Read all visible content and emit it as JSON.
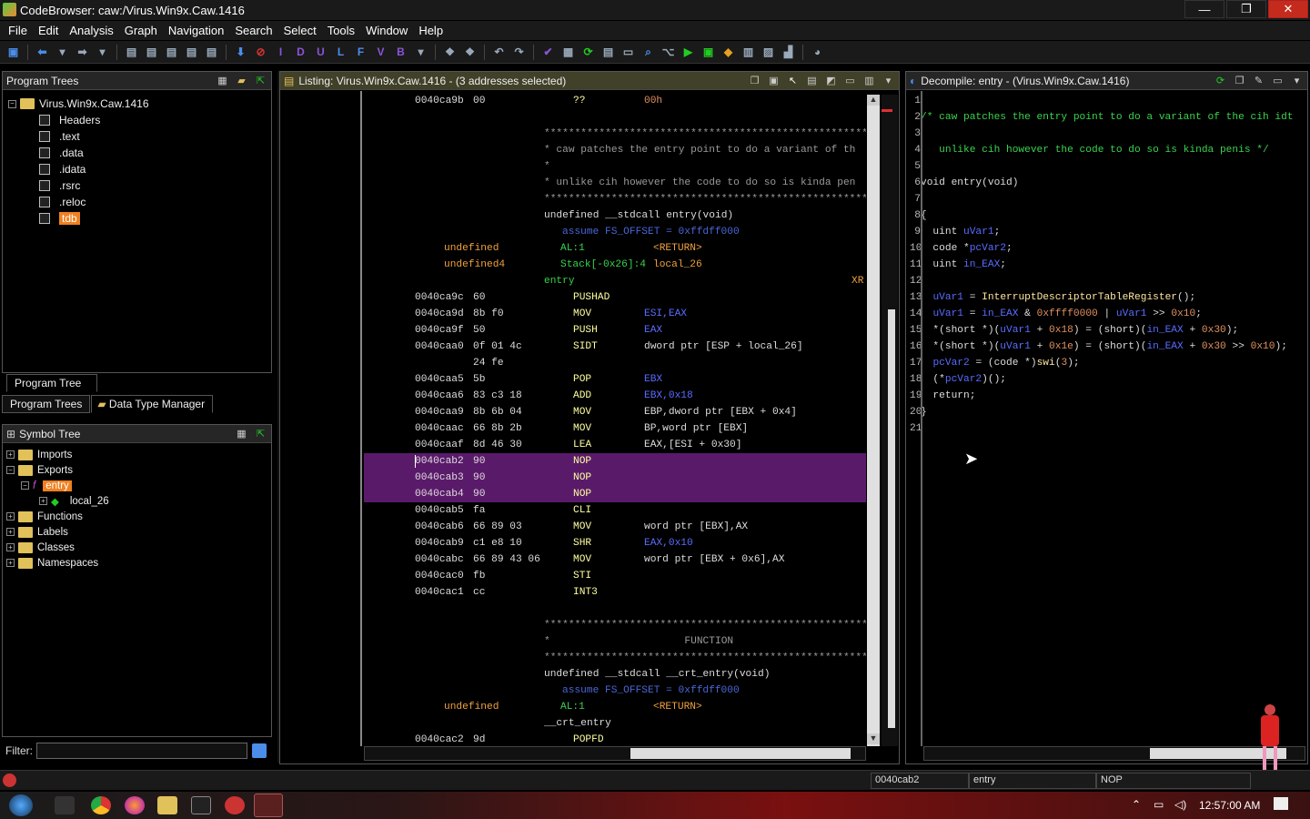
{
  "window": {
    "title": "CodeBrowser: caw:/Virus.Win9x.Caw.1416",
    "min": "—",
    "max": "❐",
    "close": "✕"
  },
  "menu": [
    "File",
    "Edit",
    "Analysis",
    "Graph",
    "Navigation",
    "Search",
    "Select",
    "Tools",
    "Window",
    "Help"
  ],
  "toolbar_letters": [
    "I",
    "D",
    "U",
    "L",
    "F",
    "V",
    "B"
  ],
  "program_trees": {
    "header": "Program Trees",
    "root": "Virus.Win9x.Caw.1416",
    "items": [
      "Headers",
      ".text",
      ".data",
      ".idata",
      ".rsrc",
      ".reloc",
      "tdb"
    ],
    "tab_program_tree": "Program Tree",
    "tab_program_trees": "Program Trees",
    "tab_dtm": "Data Type Manager"
  },
  "symbol_tree": {
    "header": "Symbol Tree",
    "imports": "Imports",
    "exports": "Exports",
    "entry": "entry",
    "local": "local_26",
    "functions": "Functions",
    "labels": "Labels",
    "classes": "Classes",
    "namespaces": "Namespaces"
  },
  "filter": {
    "label": "Filter:",
    "value": ""
  },
  "listing": {
    "title": "Listing:  Virus.Win9x.Caw.1416 - (3 addresses selected)"
  },
  "decompile": {
    "title": "Decompile: entry -  (Virus.Win9x.Caw.1416)"
  },
  "status": {
    "addr": "0040cab2",
    "func": "entry",
    "instr": "NOP"
  },
  "taskbar": {
    "time": "12:57:00 AM"
  },
  "listing_lines": [
    {
      "a": "0040ca9b",
      "b": "00",
      "m": "??",
      "o": "00h",
      "oc": "c-num"
    },
    {},
    {
      "cmt": "*******************************************************"
    },
    {
      "cmt": "* caw patches the entry point to do a variant of th"
    },
    {
      "cmt": "*"
    },
    {
      "cmt": "* unlike cih however the code to do so is kinda pen"
    },
    {
      "cmt": "*******************************************************"
    },
    {
      "sig": "undefined __stdcall entry(void)"
    },
    {
      "asm": "assume FS_OFFSET = 0xffdff000"
    },
    {
      "t": "undefined",
      "r": "AL:1",
      "v": "<RETURN>"
    },
    {
      "t": "undefined4",
      "r": "Stack[-0x26]:4",
      "v": "local_26"
    },
    {
      "lbl": "entry",
      "x": "XR"
    },
    {
      "a": "0040ca9c",
      "b": "60",
      "m": "PUSHAD"
    },
    {
      "a": "0040ca9d",
      "b": "8b f0",
      "m": "MOV",
      "o": "ESI,EAX",
      "oc": "c-reg"
    },
    {
      "a": "0040ca9f",
      "b": "50",
      "m": "PUSH",
      "o": "EAX",
      "oc": "c-reg"
    },
    {
      "a": "0040caa0",
      "b": "0f 01 4c",
      "m": "SIDT",
      "o": "dword ptr [ESP + local_26]",
      "oc": "c-addr"
    },
    {
      "b2": "24 fe"
    },
    {
      "a": "0040caa5",
      "b": "5b",
      "m": "POP",
      "o": "EBX",
      "oc": "c-reg"
    },
    {
      "a": "0040caa6",
      "b": "83 c3 18",
      "m": "ADD",
      "o": "EBX,0x18",
      "oc": "c-reg"
    },
    {
      "a": "0040caa9",
      "b": "8b 6b 04",
      "m": "MOV",
      "o": "EBP,dword ptr [EBX + 0x4]",
      "oc": "c-addr"
    },
    {
      "a": "0040caac",
      "b": "66 8b 2b",
      "m": "MOV",
      "o": "BP,word ptr [EBX]",
      "oc": "c-addr"
    },
    {
      "a": "0040caaf",
      "b": "8d 46 30",
      "m": "LEA",
      "o": "EAX,[ESI + 0x30]",
      "oc": "c-addr"
    },
    {
      "a": "0040cab2",
      "b": "90",
      "m": "NOP",
      "sel": true
    },
    {
      "a": "0040cab3",
      "b": "90",
      "m": "NOP",
      "sel": true
    },
    {
      "a": "0040cab4",
      "b": "90",
      "m": "NOP",
      "sel": true
    },
    {
      "a": "0040cab5",
      "b": "fa",
      "m": "CLI"
    },
    {
      "a": "0040cab6",
      "b": "66 89 03",
      "m": "MOV",
      "o": "word ptr [EBX],AX",
      "oc": "c-addr"
    },
    {
      "a": "0040cab9",
      "b": "c1 e8 10",
      "m": "SHR",
      "o": "EAX,0x10",
      "oc": "c-reg"
    },
    {
      "a": "0040cabc",
      "b": "66 89 43 06",
      "m": "MOV",
      "o": "word ptr [EBX + 0x6],AX",
      "oc": "c-addr"
    },
    {
      "a": "0040cac0",
      "b": "fb",
      "m": "STI"
    },
    {
      "a": "0040cac1",
      "b": "cc",
      "m": "INT3"
    },
    {},
    {
      "cmt": "*******************************************************"
    },
    {
      "cmt": "*                      FUNCTION"
    },
    {
      "cmt": "*******************************************************"
    },
    {
      "sig": "undefined __stdcall __crt_entry(void)"
    },
    {
      "asm": "assume FS_OFFSET = 0xffdff000"
    },
    {
      "t": "undefined",
      "r": "AL:1",
      "v": "<RETURN>"
    },
    {
      "lbl2": "__crt_entry"
    },
    {
      "a": "0040cac2",
      "b": "9d",
      "m": "POPFD"
    }
  ],
  "decomp_lines": [
    {
      "n": "1",
      "h": ""
    },
    {
      "n": "2",
      "h": "<span class='c-lbl'>/* caw patches the entry point to do a variant of the cih idt</span>"
    },
    {
      "n": "3",
      "h": ""
    },
    {
      "n": "4",
      "h": "<span class='c-lbl'>   unlike cih however the code to do so is kinda penis */</span>"
    },
    {
      "n": "5",
      "h": ""
    },
    {
      "n": "6",
      "h": "void entry(void)"
    },
    {
      "n": "7",
      "h": ""
    },
    {
      "n": "8",
      "h": "{"
    },
    {
      "n": "9",
      "h": "  uint <span class='c-reg'>uVar1</span>;"
    },
    {
      "n": "10",
      "h": "  code *<span class='c-reg'>pcVar2</span>;"
    },
    {
      "n": "11",
      "h": "  uint <span class='c-reg'>in_EAX</span>;"
    },
    {
      "n": "12",
      "h": ""
    },
    {
      "n": "13",
      "h": "  <span class='c-reg'>uVar1</span> = <span class='c-fn'>InterruptDescriptorTableRegister</span>();"
    },
    {
      "n": "14",
      "h": "  <span class='c-reg'>uVar1</span> = <span class='c-reg'>in_EAX</span> &amp; <span class='c-num'>0xffff0000</span> | <span class='c-reg'>uVar1</span> &gt;&gt; <span class='c-num'>0x10</span>;"
    },
    {
      "n": "15",
      "h": "  *(short *)(<span class='c-reg'>uVar1</span> + <span class='c-num'>0x18</span>) = (short)(<span class='c-reg'>in_EAX</span> + <span class='c-num'>0x30</span>);"
    },
    {
      "n": "16",
      "h": "  *(short *)(<span class='c-reg'>uVar1</span> + <span class='c-num'>0x1e</span>) = (short)(<span class='c-reg'>in_EAX</span> + <span class='c-num'>0x30</span> &gt;&gt; <span class='c-num'>0x10</span>);"
    },
    {
      "n": "17",
      "h": "  <span class='c-reg'>pcVar2</span> = (code *)<span class='c-fn'>swi</span>(<span class='c-num'>3</span>);"
    },
    {
      "n": "18",
      "h": "  (*<span class='c-reg'>pcVar2</span>)();"
    },
    {
      "n": "19",
      "h": "  return;"
    },
    {
      "n": "20",
      "h": "}"
    },
    {
      "n": "21",
      "h": ""
    }
  ]
}
